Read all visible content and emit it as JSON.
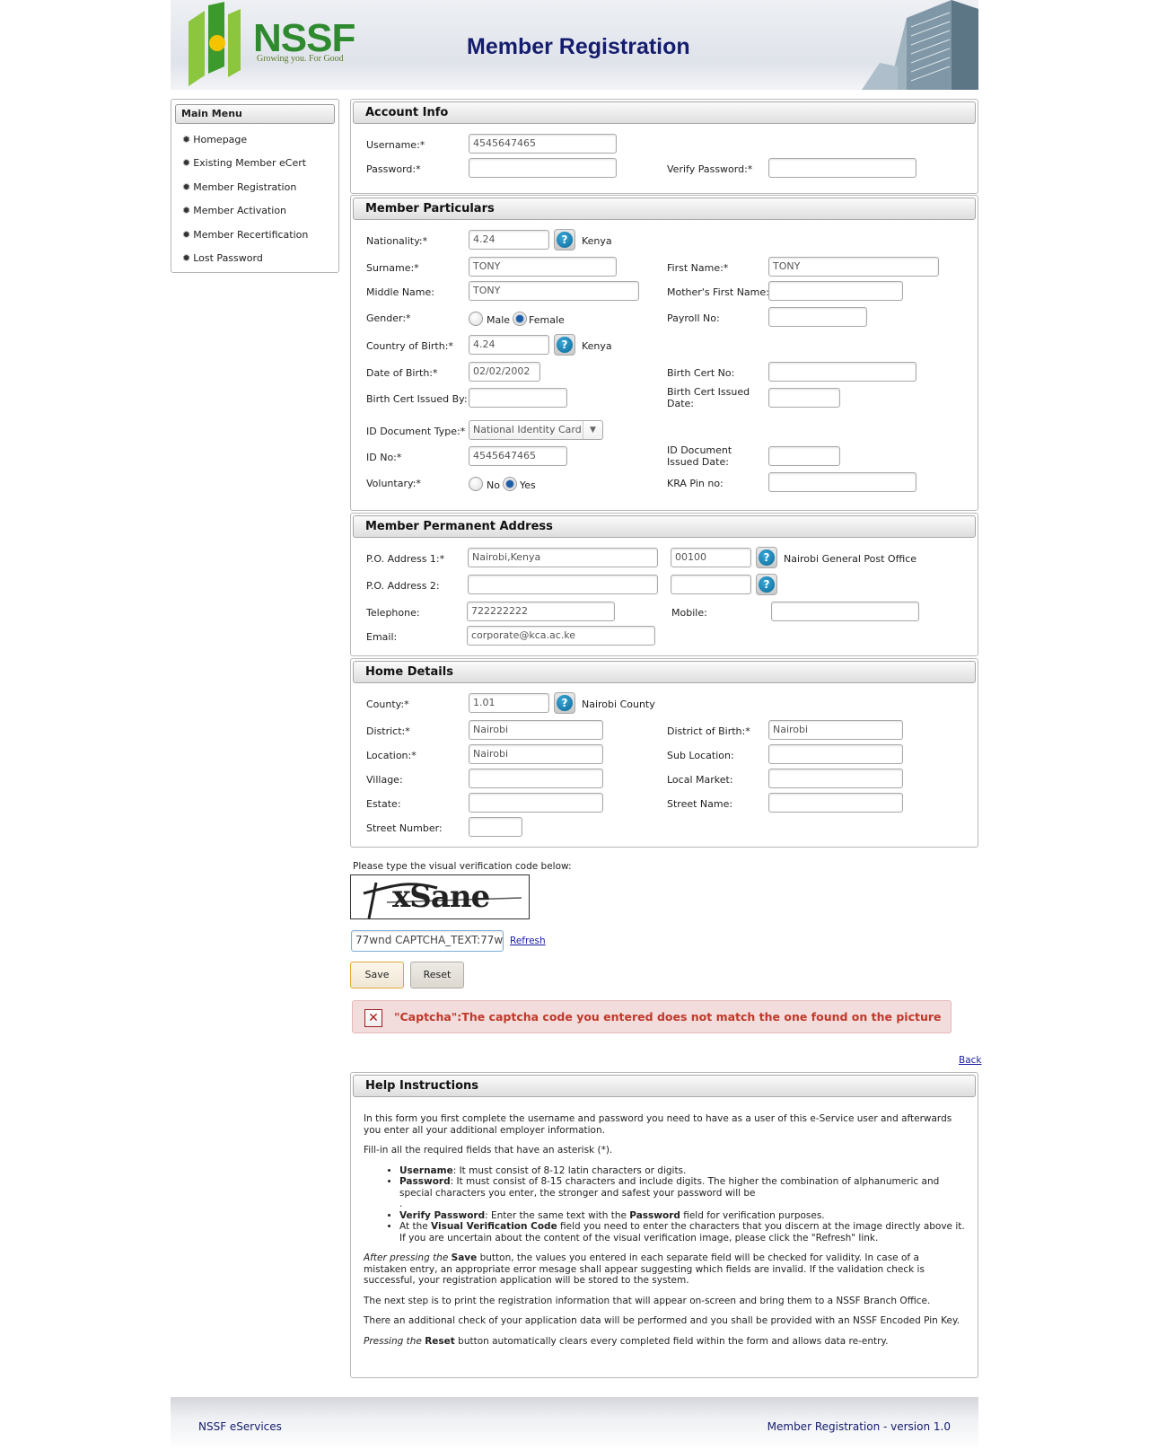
{
  "header": {
    "logo_text": "NSSF",
    "logo_tagline": "Growing you. For Good",
    "title": "Member Registration"
  },
  "sidebar": {
    "title": "Main Menu",
    "items": [
      {
        "label": "Homepage"
      },
      {
        "label": "Existing Member eCert"
      },
      {
        "label": "Member Registration"
      },
      {
        "label": "Member Activation"
      },
      {
        "label": "Member Recertification"
      },
      {
        "label": "Lost Password"
      }
    ]
  },
  "account": {
    "heading": "Account Info",
    "username_label": "Username:*",
    "username_value": "4545647465",
    "password_label": "Password:*",
    "password_value": "",
    "verify_label": "Verify Password:*",
    "verify_value": ""
  },
  "particulars": {
    "heading": "Member Particulars",
    "nationality_label": "Nationality:*",
    "nationality_value": "4.24",
    "nationality_name": "Kenya",
    "surname_label": "Surname:*",
    "surname_value": "TONY",
    "first_name_label": "First Name:*",
    "first_name_value": "TONY",
    "middle_name_label": "Middle Name:",
    "middle_name_value": "TONY",
    "mother_label": "Mother's First Name:",
    "mother_value": "",
    "gender_label": "Gender:*",
    "gender_options": [
      "Male",
      "Female"
    ],
    "gender_selected": "Female",
    "payroll_label": "Payroll No:",
    "payroll_value": "",
    "country_birth_label": "Country of Birth:*",
    "country_birth_value": "4.24",
    "country_birth_name": "Kenya",
    "dob_label": "Date of Birth:*",
    "dob_value": "02/02/2002",
    "birth_cert_no_label": "Birth Cert No:",
    "birth_cert_no_value": "",
    "birth_cert_by_label": "Birth Cert Issued By:",
    "birth_cert_by_value": "",
    "birth_cert_date_label": "Birth Cert Issued Date:",
    "birth_cert_date_value": "",
    "id_type_label": "ID Document Type:*",
    "id_type_value": "National Identity Card",
    "id_no_label": "ID No:*",
    "id_no_value": "4545647465",
    "id_date_label": "ID Document Issued Date:",
    "id_date_value": "",
    "voluntary_label": "Voluntary:*",
    "voluntary_options": [
      "No",
      "Yes"
    ],
    "voluntary_selected": "Yes",
    "kra_label": "KRA Pin no:",
    "kra_value": ""
  },
  "address": {
    "heading": "Member Permanent Address",
    "po1_label": "P.O. Address 1:*",
    "po1_value": "Nairobi,Kenya",
    "po1_code": "00100",
    "po1_office": "Nairobi General Post Office",
    "po2_label": "P.O. Address 2:",
    "po2_value": "",
    "po2_code": "",
    "telephone_label": "Telephone:",
    "telephone_value": "722222222",
    "mobile_label": "Mobile:",
    "mobile_value": "",
    "email_label": "Email:",
    "email_value": "corporate@kca.ac.ke"
  },
  "home": {
    "heading": "Home Details",
    "county_label": "County:*",
    "county_value": "1.01",
    "county_name": "Nairobi County",
    "district_label": "District:*",
    "district_value": "Nairobi",
    "district_birth_label": "District of Birth:*",
    "district_birth_value": "Nairobi",
    "location_label": "Location:*",
    "location_value": "Nairobi",
    "sublocation_label": "Sub Location:",
    "sublocation_value": "",
    "village_label": "Village:",
    "village_value": "",
    "market_label": "Local Market:",
    "market_value": "",
    "estate_label": "Estate:",
    "estate_value": "",
    "street_name_label": "Street Name:",
    "street_name_value": "",
    "street_number_label": "Street Number:",
    "street_number_value": ""
  },
  "captcha": {
    "prompt": "Please type the visual verification code below:",
    "image_text": "xSane",
    "input_value": "77wnd CAPTCHA_TEXT:77w",
    "refresh_label": "Refresh"
  },
  "actions": {
    "save_label": "Save",
    "reset_label": "Reset",
    "back_label": "Back"
  },
  "error": {
    "icon": "x-icon",
    "message": "\"Captcha\":The captcha code you entered does not match the one found on the picture"
  },
  "help": {
    "heading": "Help Instructions",
    "p1": "In this form you first complete the username and password you need to have as a user of this e-Service user and afterwards you enter all your additional employer information.",
    "p2": "Fill-in all the required fields that have an asterisk (*).",
    "bullets": [
      {
        "term": "Username",
        "text": ": It must consist of 8-12 latin characters or digits."
      },
      {
        "term": "Password",
        "text": ": It must consist of 8-15 characters and include digits. The higher the combination of alphanumeric and special characters you enter, the stronger and safest your password will be"
      },
      {
        "term": "Verify Password",
        "text": ": Enter the same text with the ",
        "term2": "Password",
        "text2": " field for verification purposes."
      },
      {
        "pre": "At the ",
        "term": "Visual Verification Code",
        "text": " field you need to enter the characters that you discern at the image directly above it. If you are uncertain about the content of the visual verification image, please click the \"Refresh\" link."
      }
    ],
    "p3_italic": "After pressing the ",
    "p3_bold": "Save",
    "p3_text": " button, the values you entered in each separate field will be checked for validity. In case of a mistaken entry, an appropriate error mesage shall appear suggesting which fields are invalid. If the validation check is successful, your registration application will be stored to the system.",
    "p4": "The next step is to print the registration information that will appear on-screen and bring them to a NSSF Branch Office.",
    "p5": "There an additional check of your application data will be performed and you shall be provided with an NSSF Encoded Pin Key.",
    "p6_italic": "Pressing the ",
    "p6_bold": "Reset",
    "p6_text": " button automatically clears every completed field within the form and allows data re-entry."
  },
  "footer": {
    "left": "NSSF eServices",
    "right": "Member Registration - version 1.0"
  }
}
